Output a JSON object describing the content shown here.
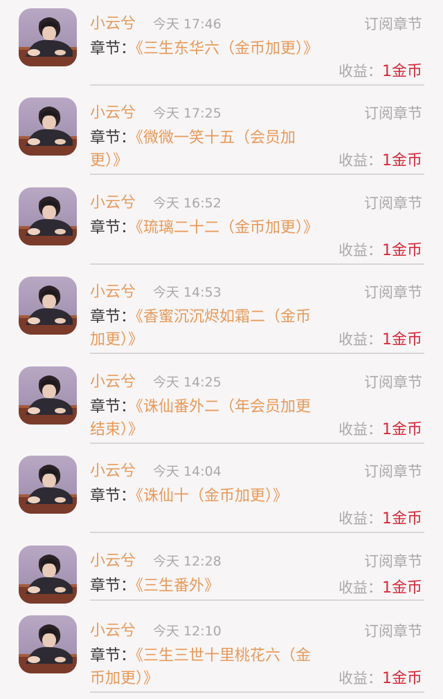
{
  "records": [
    {
      "name": "小云兮",
      "time": "今天 17:46",
      "type": "订阅章节",
      "chapter_label": "章节：",
      "chapter_title": "《三生东华六（金币加更）》",
      "income_label": "收益：",
      "income_value": "1金币"
    },
    {
      "name": "小云兮",
      "time": "今天 17:25",
      "type": "订阅章节",
      "chapter_label": "章节：",
      "chapter_title": "《微微一笑十五（会员加更）》",
      "income_label": "收益：",
      "income_value": "1金币"
    },
    {
      "name": "小云兮",
      "time": "今天 16:52",
      "type": "订阅章节",
      "chapter_label": "章节：",
      "chapter_title": "《琉璃二十二（金币加更）》",
      "income_label": "收益：",
      "income_value": "1金币"
    },
    {
      "name": "小云兮",
      "time": "今天 14:53",
      "type": "订阅章节",
      "chapter_label": "章节：",
      "chapter_title": "《香蜜沉沉烬如霜二（金币加更）》",
      "income_label": "收益：",
      "income_value": "1金币"
    },
    {
      "name": "小云兮",
      "time": "今天 14:25",
      "type": "订阅章节",
      "chapter_label": "章节：",
      "chapter_title": "《诛仙番外二（年会员加更结束）》",
      "income_label": "收益：",
      "income_value": "1金币"
    },
    {
      "name": "小云兮",
      "time": "今天 14:04",
      "type": "订阅章节",
      "chapter_label": "章节：",
      "chapter_title": "《诛仙十（金币加更）》",
      "income_label": "收益：",
      "income_value": "1金币"
    },
    {
      "name": "小云兮",
      "time": "今天 12:28",
      "type": "订阅章节",
      "chapter_label": "章节：",
      "chapter_title": "《三生番外》",
      "income_label": "收益：",
      "income_value": "1金币"
    },
    {
      "name": "小云兮",
      "time": "今天 12:10",
      "type": "订阅章节",
      "chapter_label": "章节：",
      "chapter_title": "《三生三世十里桃花六（金币加更）》",
      "income_label": "收益：",
      "income_value": "1金币"
    }
  ],
  "icons": {
    "avatar": "user-avatar-photo"
  },
  "colors": {
    "name": "#e79a5a",
    "amount": "#d42a3a",
    "muted": "#a9a9a9",
    "background": "#f8f5f6"
  }
}
